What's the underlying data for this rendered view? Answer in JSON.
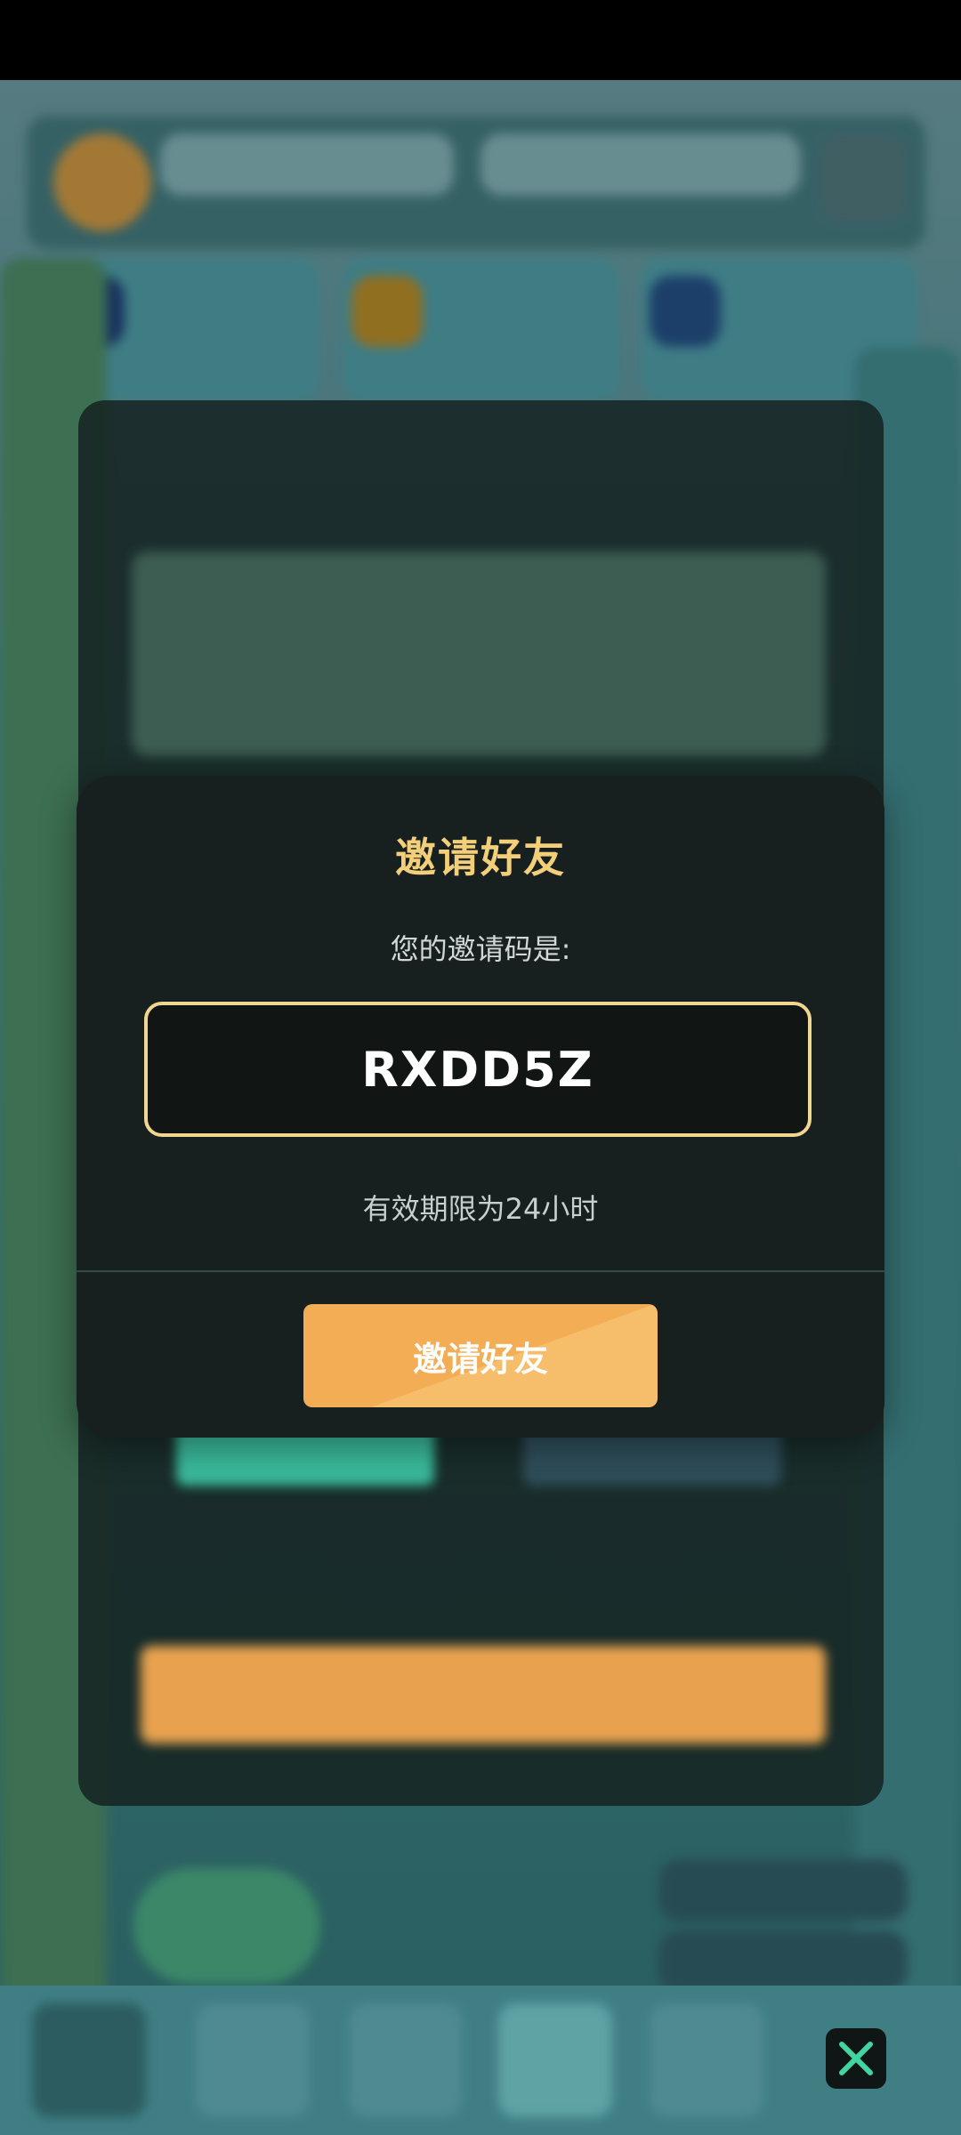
{
  "modal": {
    "title": "邀请好友",
    "subtitle": "您的邀请码是:",
    "code": "RXDD5Z",
    "validity": "有效期限为24小时",
    "button_label": "邀请好友"
  },
  "close": {
    "icon": "close-icon"
  },
  "colors": {
    "accent_title": "#f4cf79",
    "code_border": "#f0d690",
    "button": "#f2ad55",
    "modal_bg": "#17201f",
    "close_icon": "#3fd6a1"
  }
}
